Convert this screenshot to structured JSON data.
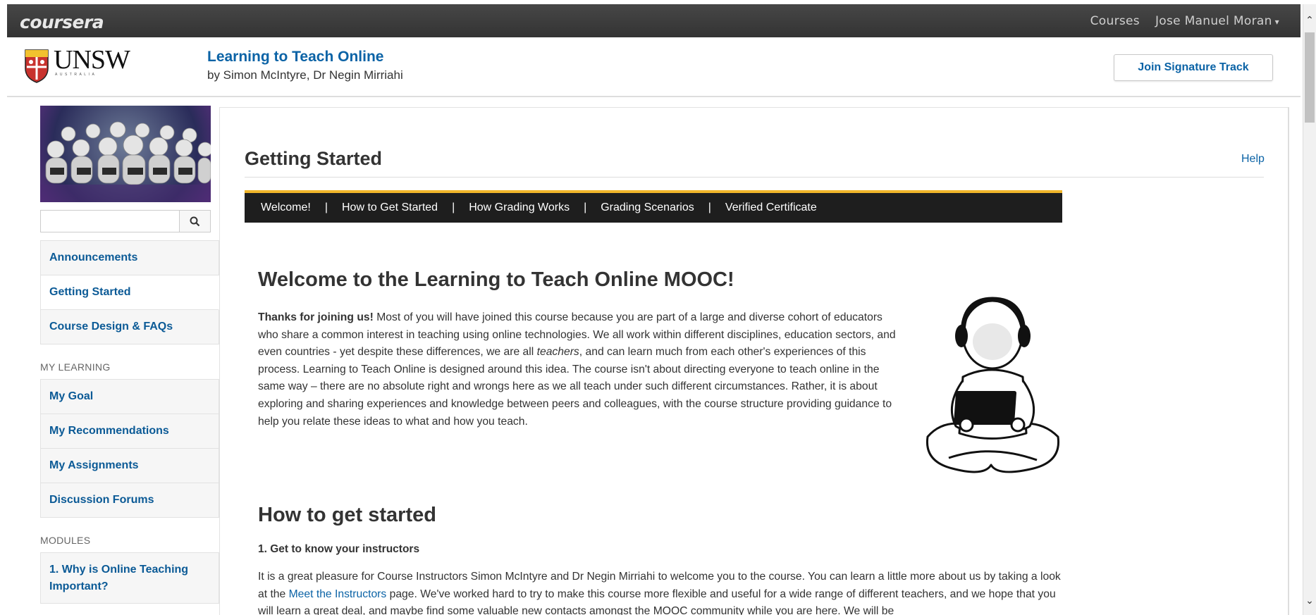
{
  "topbar": {
    "logo": "coursera",
    "nav_courses": "Courses",
    "user_name": "Jose Manuel Moran",
    "user_caret": "▾"
  },
  "header": {
    "institution": "UNSW",
    "institution_sub": "AUSTRALIA",
    "course_title": "Learning to Teach Online",
    "course_by": "by Simon McIntyre, Dr Negin Mirriahi",
    "signature_button": "Join Signature Track"
  },
  "sidebar": {
    "search_placeholder": "",
    "top_items": [
      "Announcements",
      "Getting Started",
      "Course Design & FAQs"
    ],
    "my_learning_heading": "MY LEARNING",
    "my_learning_items": [
      "My Goal",
      "My Recommendations",
      "My Assignments",
      "Discussion Forums"
    ],
    "modules_heading": "MODULES",
    "module_items": [
      "1. Why is Online Teaching Important?"
    ]
  },
  "main": {
    "page_title": "Getting Started",
    "help_link": "Help",
    "tabs": [
      "Welcome!",
      "How to Get Started",
      "How Grading Works",
      "Grading Scenarios",
      "Verified Certificate"
    ],
    "tab_separator": "|",
    "welcome_heading": "Welcome to the Learning to Teach Online MOOC!",
    "intro_bold": "Thanks for joining us!",
    "intro_part1": " Most of you will have joined this course because you are part of a large and diverse cohort of educators who share a common interest in teaching using online technologies. We all work within different disciplines, education sectors, and even countries - yet despite these differences, we are all ",
    "intro_italic": "teachers",
    "intro_part2": ", and can learn much from each other's experiences of this process. Learning to Teach Online is designed around this idea. The course isn't about directing everyone to teach online in the same way – there are no absolute right and wrongs here as we all teach under such different circumstances. Rather, it is about exploring and sharing experiences and knowledge between peers and colleagues, with the course structure providing guidance to help you relate these ideas to what and how you teach.",
    "started_heading": "How to get started",
    "step1_heading": "1. Get to know your instructors",
    "step1_part1": "It is a great pleasure for Course Instructors Simon McIntyre and Dr Negin Mirriahi to welcome you to the course. You can learn a little more about us by taking a look at the ",
    "step1_link": "Meet the Instructors",
    "step1_part2": " page. We've worked hard to try to make this course more flexible and useful for a wide range of different teachers, and we hope that you will learn a great deal, and maybe find some valuable new contacts amongst the MOOC community while you are here. We will be"
  },
  "colors": {
    "topbar": "#3e3e3e",
    "link": "#0b63a6",
    "tab_accent": "#f0b52a",
    "tabbar": "#1e1e1e"
  }
}
